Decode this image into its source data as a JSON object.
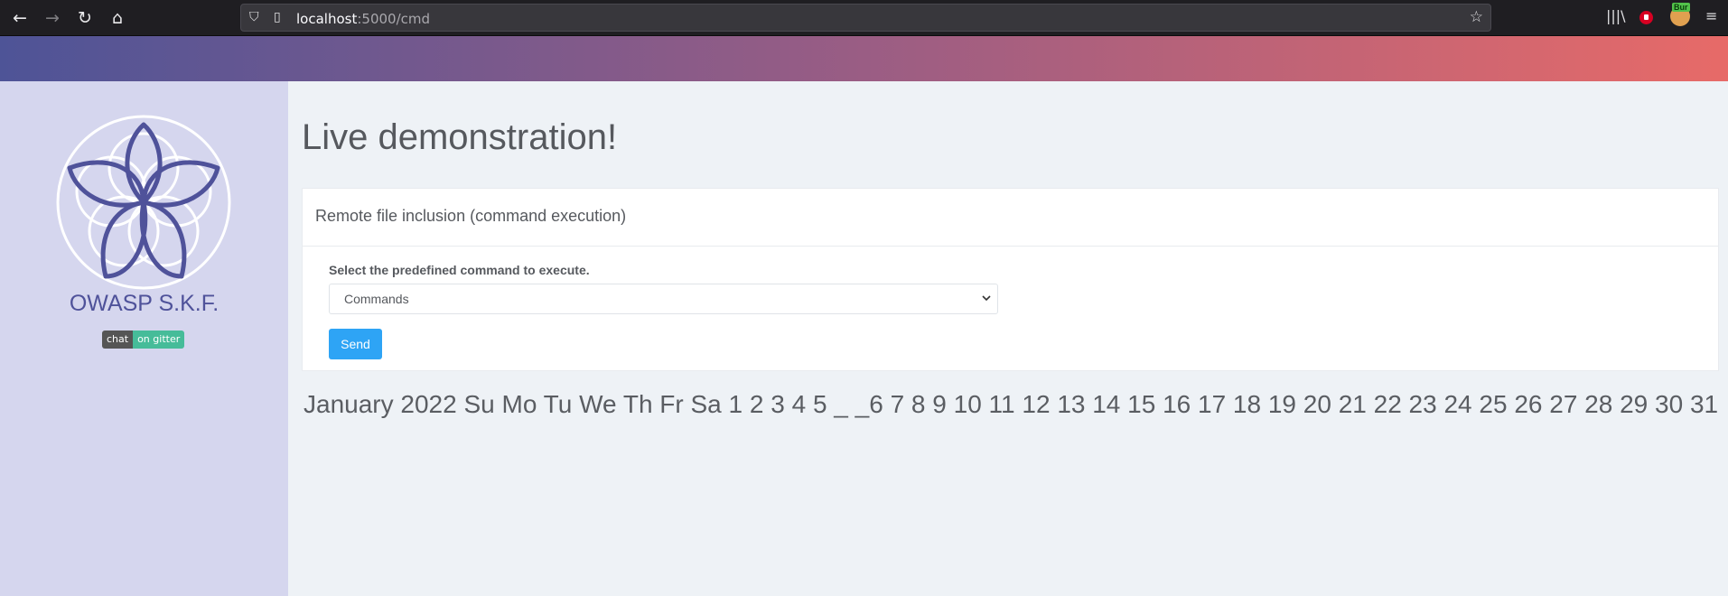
{
  "browser": {
    "url_host": "localhost",
    "url_path": ":5000/cmd",
    "icons": {
      "back": "back-arrow-icon",
      "forward": "forward-arrow-icon",
      "reload": "reload-icon",
      "home": "home-icon",
      "shield": "tracking-shield-icon",
      "page": "page-info-icon",
      "bookmark": "star-icon",
      "library": "library-icon",
      "menu": "hamburger-menu-icon"
    },
    "extensions": {
      "burp_label": "Bur"
    }
  },
  "sidebar": {
    "brand": "OWASP S.K.F.",
    "badge_left": "chat",
    "badge_right": "on gitter"
  },
  "main": {
    "title": "Live demonstration!",
    "card_title": "Remote file inclusion (command execution)",
    "form_label": "Select the predefined command to execute.",
    "select_value": "Commands",
    "send_label": "Send",
    "calendar_text": "January 2022 Su Mo Tu We Th Fr Sa 1 2 3 4 5 _ _6 7 8 9 10 11 12 13 14 15 16 17 18 19 20 21 22 23 24 25 26 27 28 29 30 31"
  },
  "colors": {
    "sidebar_bg": "#d5d6ee",
    "brand": "#4f529a",
    "gradient_start": "#4e5497",
    "gradient_end": "#e76a68",
    "send_button": "#2ea4f5",
    "badge_right": "#46bc99"
  }
}
